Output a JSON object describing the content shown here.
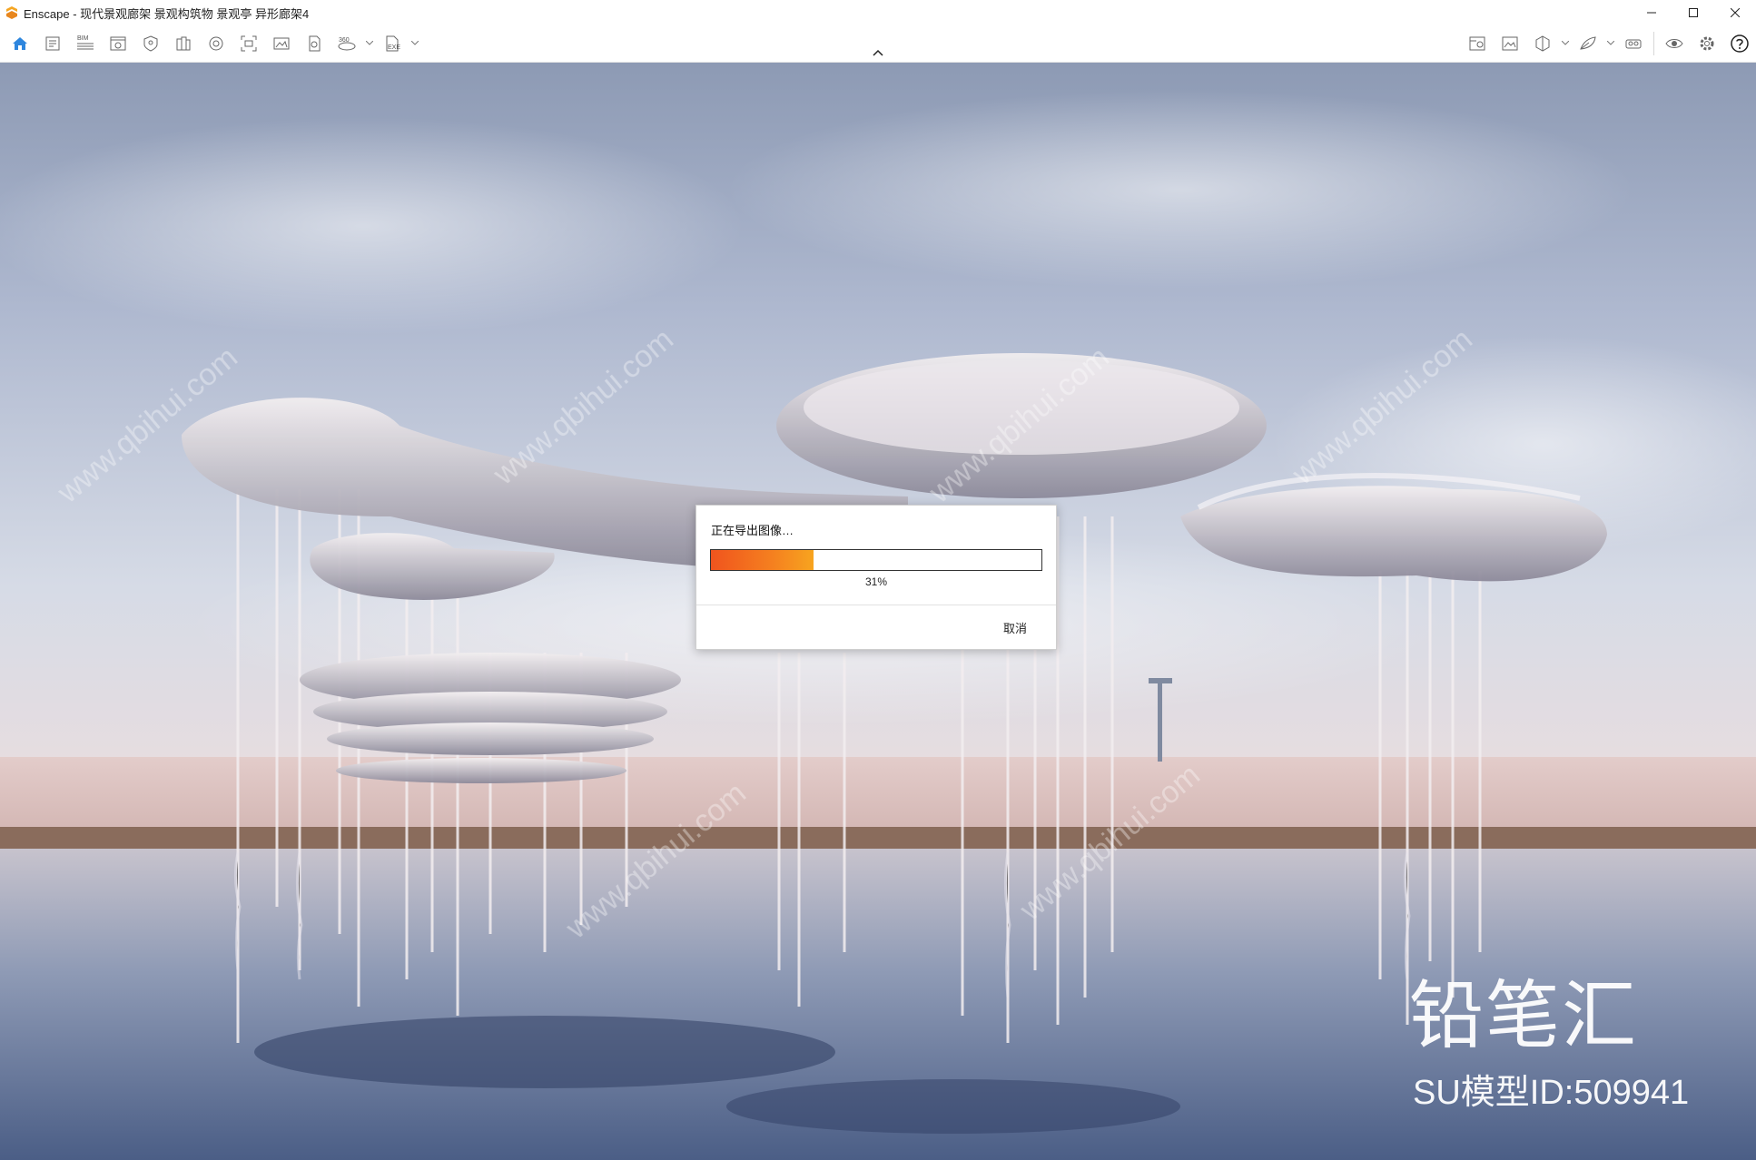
{
  "window": {
    "title": "Enscape - 现代景观廊架 景观构筑物 景观亭 异形廊架4",
    "accent": "#f5a623"
  },
  "toolbar": {
    "left_icons": [
      "home-icon",
      "notes-icon",
      "bim-icon",
      "panorama-window-icon",
      "visual-settings-icon",
      "materials-icon",
      "objects-icon",
      "screenshot-icon",
      "batch-render-icon",
      "render-image-icon",
      "export-icon",
      "panorama-360-icon",
      "exe-export-icon"
    ],
    "bim_label": "BIM",
    "pano_label": "360",
    "exe_label": "EXE",
    "right_icons": [
      "site-context-icon",
      "image-gallery-icon",
      "view-cube-icon",
      "material-editor-icon",
      "vr-headset-icon",
      "eye-icon",
      "settings-gear-icon",
      "help-icon"
    ]
  },
  "dialog": {
    "title": "正在导出图像…",
    "progress": 0.31,
    "percent_label": "31%",
    "cancel_label": "取消"
  },
  "watermark": {
    "brand": "铅笔汇",
    "model_id": "SU模型ID:509941",
    "diagonal": "www.qbihui.com"
  }
}
